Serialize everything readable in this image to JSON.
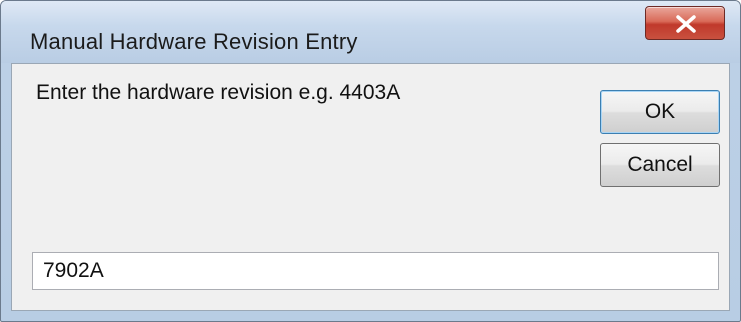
{
  "window": {
    "title": "Manual Hardware Revision Entry",
    "close_icon": "close-x-icon"
  },
  "dialog": {
    "prompt": "Enter the hardware revision e.g. 4403A",
    "ok_label": "OK",
    "cancel_label": "Cancel",
    "revision_value": "7902A"
  },
  "colors": {
    "close_button": "#c9513f",
    "client_background": "#f0f0f0",
    "frame": "#b9cde4"
  }
}
